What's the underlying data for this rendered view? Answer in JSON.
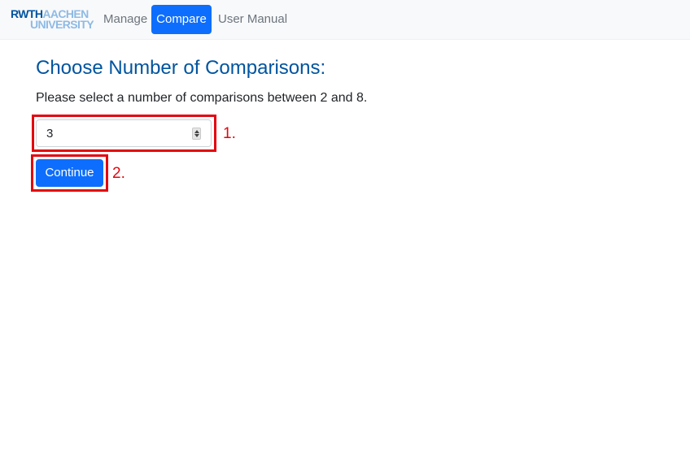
{
  "navbar": {
    "logo": {
      "line1_a": "RWTH",
      "line1_b": "AACHEN",
      "line2": "UNIVERSITY"
    },
    "links": [
      {
        "label": "Manage",
        "active": false
      },
      {
        "label": "Compare",
        "active": true
      },
      {
        "label": "User Manual",
        "active": false
      }
    ]
  },
  "main": {
    "title": "Choose Number of Comparisons:",
    "instructions": "Please select a number of comparisons between 2 and 8.",
    "number_input": {
      "value": "3",
      "min": "2",
      "max": "8"
    },
    "continue_label": "Continue",
    "annotations": [
      "1.",
      "2."
    ]
  },
  "colors": {
    "brand_blue": "#00549f",
    "brand_light_blue": "#8ebae5",
    "primary": "#0d6efd",
    "annotation_red": "#e3060f"
  }
}
